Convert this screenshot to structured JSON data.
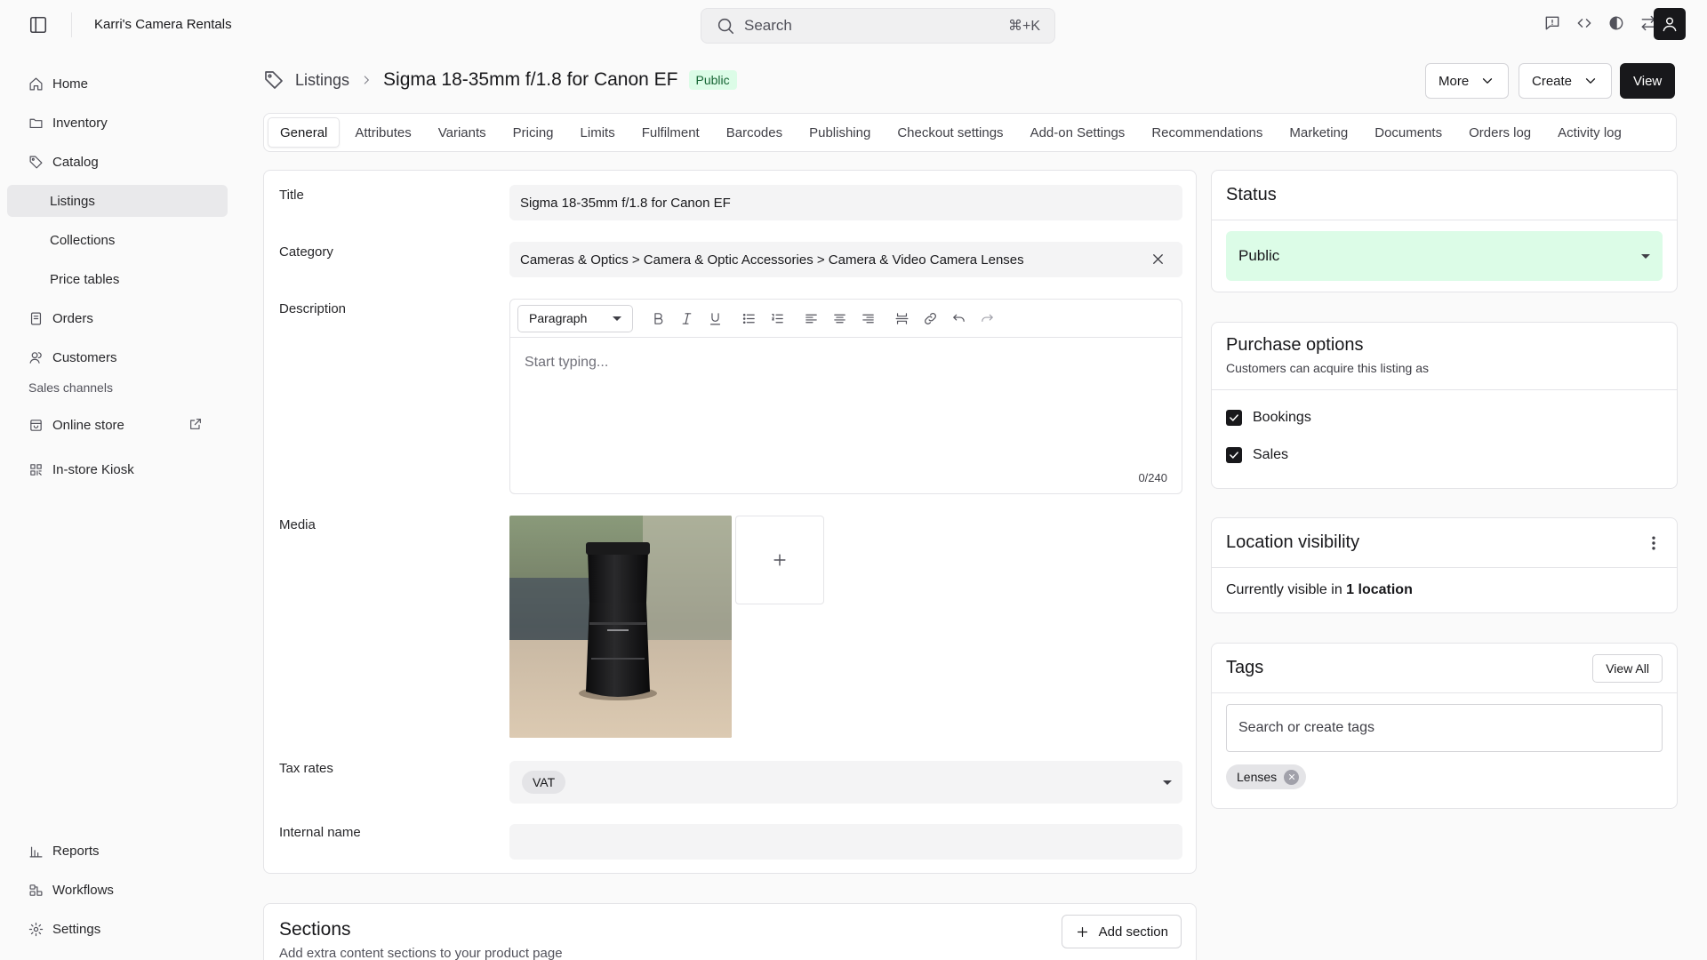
{
  "topbar": {
    "store_name": "Karri's Camera Rentals",
    "search_placeholder": "Search",
    "search_shortcut": "⌘+K"
  },
  "sidebar": {
    "items": [
      {
        "label": "Home"
      },
      {
        "label": "Inventory"
      },
      {
        "label": "Catalog"
      },
      {
        "label": "Listings"
      },
      {
        "label": "Collections"
      },
      {
        "label": "Price tables"
      },
      {
        "label": "Orders"
      },
      {
        "label": "Customers"
      }
    ],
    "sales_channels_heading": "Sales channels",
    "channels": [
      {
        "label": "Online store"
      },
      {
        "label": "In-store Kiosk"
      }
    ],
    "bottom_items": [
      {
        "label": "Reports"
      },
      {
        "label": "Workflows"
      },
      {
        "label": "Settings"
      }
    ]
  },
  "header": {
    "breadcrumb": "Listings",
    "title": "Sigma 18-35mm f/1.8 for Canon EF",
    "badge": "Public",
    "more_label": "More",
    "create_label": "Create",
    "view_label": "View"
  },
  "tabs": [
    {
      "label": "General"
    },
    {
      "label": "Attributes"
    },
    {
      "label": "Variants"
    },
    {
      "label": "Pricing"
    },
    {
      "label": "Limits"
    },
    {
      "label": "Fulfilment"
    },
    {
      "label": "Barcodes"
    },
    {
      "label": "Publishing"
    },
    {
      "label": "Checkout settings"
    },
    {
      "label": "Add-on Settings"
    },
    {
      "label": "Recommendations"
    },
    {
      "label": "Marketing"
    },
    {
      "label": "Documents"
    },
    {
      "label": "Orders log"
    },
    {
      "label": "Activity log"
    }
  ],
  "form": {
    "title_label": "Title",
    "title_value": "Sigma 18-35mm f/1.8 for Canon EF",
    "category_label": "Category",
    "category_value": "Cameras & Optics > Camera & Optic Accessories > Camera & Video Camera Lenses",
    "description_label": "Description",
    "paragraph_select": "Paragraph",
    "description_placeholder": "Start typing...",
    "char_count": "0/240",
    "media_label": "Media",
    "tax_label": "Tax rates",
    "tax_chip": "VAT",
    "internal_name_label": "Internal name",
    "internal_name_value": ""
  },
  "sections": {
    "title": "Sections",
    "subtitle": "Add extra content sections to your product page",
    "add_label": "Add section"
  },
  "status_card": {
    "title": "Status",
    "value": "Public"
  },
  "purchase_card": {
    "title": "Purchase options",
    "subtitle": "Customers can acquire this listing as",
    "options": [
      {
        "label": "Bookings",
        "checked": true
      },
      {
        "label": "Sales",
        "checked": true
      }
    ]
  },
  "location_card": {
    "title": "Location visibility",
    "text_prefix": "Currently visible in",
    "text_strong": "1 location"
  },
  "tags_card": {
    "title": "Tags",
    "view_all": "View All",
    "search_placeholder": "Search or create tags",
    "tags": [
      "Lenses"
    ]
  },
  "colors": {
    "primary": "#18181b",
    "success_bg": "#dcfce7",
    "success_text": "#166534"
  }
}
